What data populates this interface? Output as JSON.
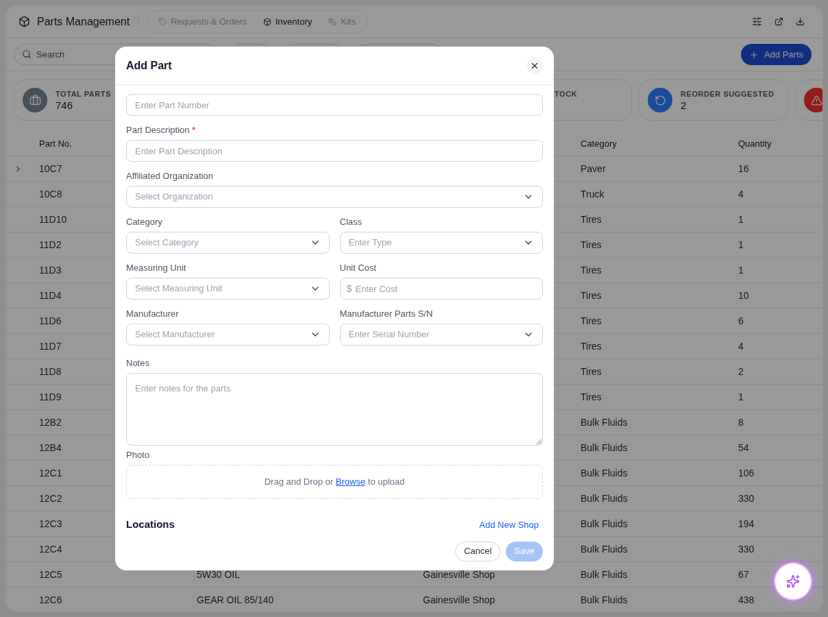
{
  "header": {
    "title": "Parts Management",
    "tabs": [
      {
        "label": "Requests & Orders",
        "kind": "tag",
        "selected": false
      },
      {
        "label": "Inventory",
        "kind": "box",
        "selected": true
      },
      {
        "label": "Kits",
        "kind": "coins",
        "selected": false
      }
    ]
  },
  "toolbar": {
    "search": {
      "placeholder": "Search"
    },
    "add_button": "Add Parts"
  },
  "stats": [
    {
      "kind": "total",
      "label": "TOTAL PARTS",
      "value": "746",
      "color": "#4a5059"
    },
    {
      "kind": "plain",
      "label": "TOCK"
    },
    {
      "kind": "reorder",
      "label": "REORDER SUGGESTED",
      "value": "2",
      "color": "#1b4b99"
    },
    {
      "kind": "alert",
      "color": "#921b1b"
    }
  ],
  "table": {
    "columns": [
      {
        "label": "Part No."
      },
      {
        "label": "Category"
      },
      {
        "label": "Quantity"
      }
    ],
    "rows": [
      {
        "part_no": "10C7",
        "expandable": true,
        "category": "Paver",
        "quantity": "16"
      },
      {
        "part_no": "10C8",
        "expandable": false,
        "category": "Truck",
        "quantity": "4"
      },
      {
        "part_no": "11D10",
        "expandable": false,
        "category": "Tires",
        "quantity": "1"
      },
      {
        "part_no": "11D2",
        "expandable": false,
        "category": "Tires",
        "quantity": "1"
      },
      {
        "part_no": "11D3",
        "expandable": false,
        "category": "Tires",
        "quantity": "1"
      },
      {
        "part_no": "11D4",
        "expandable": false,
        "category": "Tires",
        "quantity": "10"
      },
      {
        "part_no": "11D6",
        "expandable": false,
        "category": "Tires",
        "quantity": "6"
      },
      {
        "part_no": "11D7",
        "expandable": false,
        "category": "Tires",
        "quantity": "4"
      },
      {
        "part_no": "11D8",
        "expandable": false,
        "category": "Tires",
        "quantity": "2"
      },
      {
        "part_no": "11D9",
        "expandable": false,
        "category": "Tires",
        "quantity": "1"
      },
      {
        "part_no": "12B2",
        "expandable": false,
        "category": "Bulk Fluids",
        "quantity": "8"
      },
      {
        "part_no": "12B4",
        "expandable": false,
        "category": "Bulk Fluids",
        "quantity": "54"
      },
      {
        "part_no": "12C1",
        "expandable": false,
        "category": "Bulk Fluids",
        "quantity": "106"
      },
      {
        "part_no": "12C2",
        "expandable": false,
        "category": "Bulk Fluids",
        "quantity": "330"
      },
      {
        "part_no": "12C3",
        "expandable": false,
        "category": "Bulk Fluids",
        "quantity": "194"
      },
      {
        "part_no": "12C4",
        "expandable": false,
        "category": "Bulk Fluids",
        "quantity": "330"
      },
      {
        "part_no": "12C5",
        "expandable": false,
        "description": "5W30 OIL",
        "location": "Gainesville Shop",
        "category": "Bulk Fluids",
        "quantity": "67"
      },
      {
        "part_no": "12C6",
        "expandable": false,
        "description": "GEAR OIL 85/140",
        "location": "Gainesville Shop",
        "category": "Bulk Fluids",
        "quantity": "438"
      }
    ]
  },
  "modal": {
    "title": "Add Part",
    "rows": [
      [
        {
          "kind": "text",
          "placeholder": "Enter Part Number"
        }
      ],
      [
        {
          "kind": "text",
          "label": "Part Description",
          "marker": "*",
          "placeholder": "Enter Part Description"
        }
      ],
      [
        {
          "kind": "select",
          "label": "Affiliated Organization",
          "placeholder": "Select Organization"
        }
      ],
      [
        {
          "kind": "select",
          "label": "Category",
          "placeholder": "Select Category"
        },
        {
          "kind": "select",
          "label": "Class",
          "placeholder": "Enter Type"
        }
      ],
      [
        {
          "kind": "select",
          "label": "Measuring Unit",
          "placeholder": "Select Measuring Unit"
        },
        {
          "kind": "currency",
          "label": "Unit Cost",
          "prefix": "$",
          "placeholder": "Enter Cost"
        }
      ],
      [
        {
          "kind": "select",
          "label": "Manufacturer",
          "placeholder": "Select Manufacturer"
        },
        {
          "kind": "select",
          "label": "Manufacturer Parts S/N",
          "placeholder": "Enter Serial Number"
        }
      ],
      [
        {
          "kind": "textarea",
          "label": "Notes",
          "placeholder": "Enter notes for the parts"
        }
      ],
      [
        {
          "kind": "upload",
          "label": "Photo",
          "before": "Drag and Drop or",
          "link": "Browse",
          "after": "to upload"
        }
      ]
    ],
    "locations": {
      "title": "Locations",
      "link": "Add New Shop"
    },
    "cancel": "Cancel",
    "save": {
      "label": "Save",
      "disabled": true
    }
  }
}
